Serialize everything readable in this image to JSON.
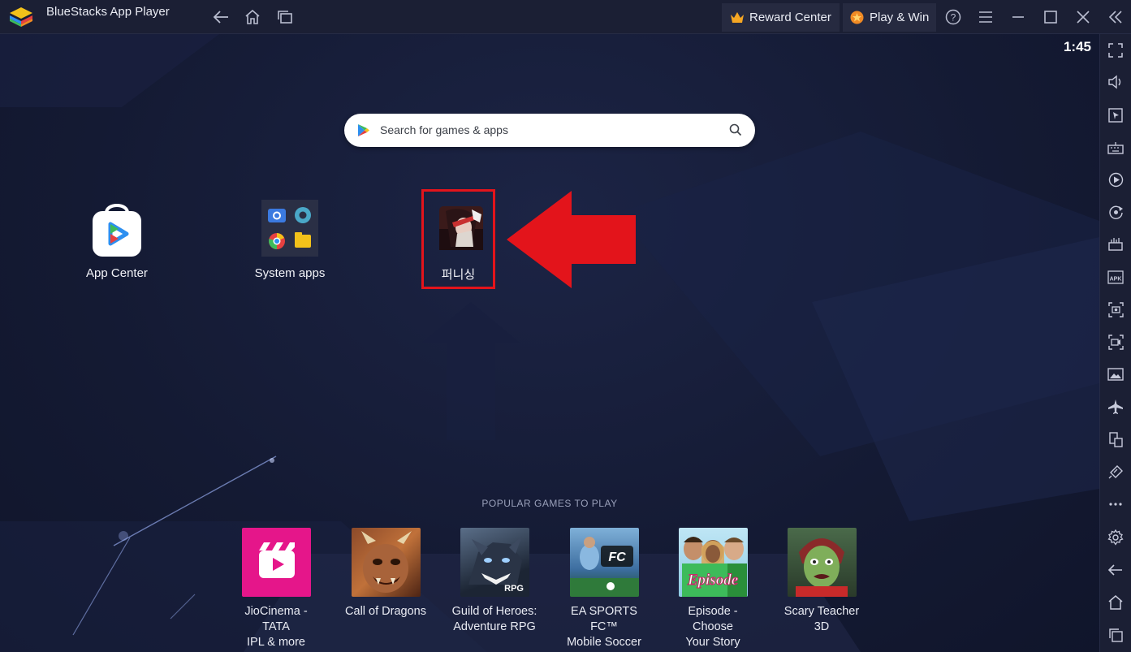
{
  "titlebar": {
    "title": "BlueStacks App Player",
    "reward_label": "Reward Center",
    "playwin_label": "Play & Win"
  },
  "status": {
    "clock": "1:45"
  },
  "search": {
    "placeholder": "Search for games & apps"
  },
  "desktop_apps": [
    {
      "label": "App Center",
      "icon": "app-center-bag-icon"
    },
    {
      "label": "System apps",
      "icon": "system-apps-folder-icon"
    },
    {
      "label": "퍼니싱",
      "icon": "punishing-game-icon"
    }
  ],
  "popular": {
    "header": "POPULAR GAMES TO PLAY",
    "games": [
      {
        "line1": "JioCinema - TATA",
        "line2": "IPL & more"
      },
      {
        "line1": "Call of Dragons",
        "line2": ""
      },
      {
        "line1": "Guild of Heroes:",
        "line2": "Adventure RPG",
        "badge": "RPG"
      },
      {
        "line1": "EA SPORTS FC™",
        "line2": "Mobile Soccer",
        "badge": "FC"
      },
      {
        "line1": "Episode - Choose",
        "line2": "Your Story",
        "badge": "Episode"
      },
      {
        "line1": "Scary Teacher 3D",
        "line2": ""
      }
    ]
  },
  "sidebar_icons": [
    "fullscreen-icon",
    "volume-icon",
    "cursor-icon",
    "keyboard-icon",
    "macro-play-icon",
    "rotate-sync-icon",
    "performance-icon",
    "apk-icon",
    "screenshot-icon",
    "record-icon",
    "media-folder-icon",
    "airplane-icon",
    "multi-instance-icon",
    "eco-mode-icon",
    "more-icon",
    "settings-icon",
    "back-icon",
    "home-icon",
    "recents-icon"
  ],
  "colors": {
    "accent_red": "#e3141b",
    "jiocinema_pink": "#e5168a",
    "background": "#141a33",
    "titlebar": "#1b1f34"
  }
}
